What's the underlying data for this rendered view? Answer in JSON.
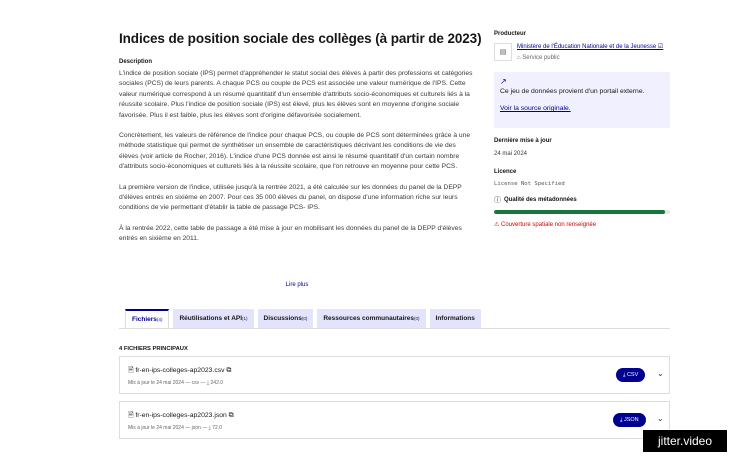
{
  "page": {
    "title": "Indices de position sociale des collèges (à partir de 2023)",
    "description_label": "Description",
    "paragraphs": [
      "L'indice de position sociale (IPS) permet d'appréhender le statut social des élèves à partir des professions et catégories sociales (PCS) de leurs parents. A chaque PCS ou couple de PCS est associée une valeur numérique de l'IPS. Cette valeur numérique correspond à un résumé quantitatif d'un ensemble d'attributs socio-économiques et culturels liés à la réussite scolaire. Plus l'indice de position sociale (IPS) est élevé, plus les élèves sont en moyenne d'origine sociale favorisée. Plus il est faible, plus les élèves sont d'origine défavorisée socialement.",
      "Concrètement, les valeurs de référence de l'indice pour chaque PCS, ou couple de PCS sont déterminées grâce à une méthode statistique qui permet de synthétiser un ensemble de caractéristiques décrivant les conditions de vie des élèves (voir article de Rocher, 2016). L'indice d'une PCS donnée est ainsi le résumé quantitatif d'un certain nombre d'attributs socio-économiques et culturels liés à la réussite scolaire, que l'on retrouve en moyenne pour cette PCS.",
      "La première version de l'indice, utilisée jusqu'à la rentrée 2021, a été calculée sur les données du panel de la DEPP d'élèves entrés en sixième en 2007. Pour ces 35 000 élèves du panel, on dispose d'une information riche sur leurs conditions de vie permettant d'établir la table de passage PCS- IPS.",
      "À la rentrée 2022, cette table de passage a été mise à jour en mobilisant les données du panel de la DEPP d'élèves entrés en sixième en 2011."
    ],
    "read_more": "Lire plus"
  },
  "sidebar": {
    "producer_label": "Producteur",
    "producer_name": "Ministère de l'Éducation Nationale et de la Jeunesse ☑",
    "producer_type": "⌂ Service public",
    "external_icon": "↗",
    "external_text": "Ce jeu de données provient d'un portail externe.",
    "external_link": "Voir la source originale.",
    "last_update_label": "Dernière mise à jour",
    "last_update_value": "24 mai 2024",
    "license_label": "Licence",
    "license_value": "License Not Specified",
    "quality_icon": "ⓘ",
    "quality_label": "Qualité des métadonnées",
    "quality_fraction": 0.97,
    "warning": "⚠ Couverture spatiale non renseignée"
  },
  "tabs": [
    {
      "label": "Fichiers",
      "count": "(4)",
      "active": true
    },
    {
      "label": "Réutilisations et API",
      "count": "(1)",
      "active": false
    },
    {
      "label": "Discussions",
      "count": "(0)",
      "active": false
    },
    {
      "label": "Ressources communautaires",
      "count": "(0)",
      "active": false
    },
    {
      "label": "Informations",
      "count": "",
      "active": false
    }
  ],
  "files": {
    "section_title": "4 FICHIERS PRINCIPAUX",
    "items": [
      {
        "name": "🗎 fr-en-ips-colleges-ap2023.csv ⧉",
        "meta": "Mis à jour le 24 mai 2024 — csv — ⤓ 242.0",
        "button": "⤓  CSV",
        "chevron": "⌄"
      },
      {
        "name": "🗎 fr-en-ips-colleges-ap2023.json ⧉",
        "meta": "Mis à jour le 24 mai 2024 — json — ⤓ 72.0",
        "button": "⤓  JSON",
        "chevron": "⌄"
      }
    ]
  },
  "watermark": "jitter.video"
}
